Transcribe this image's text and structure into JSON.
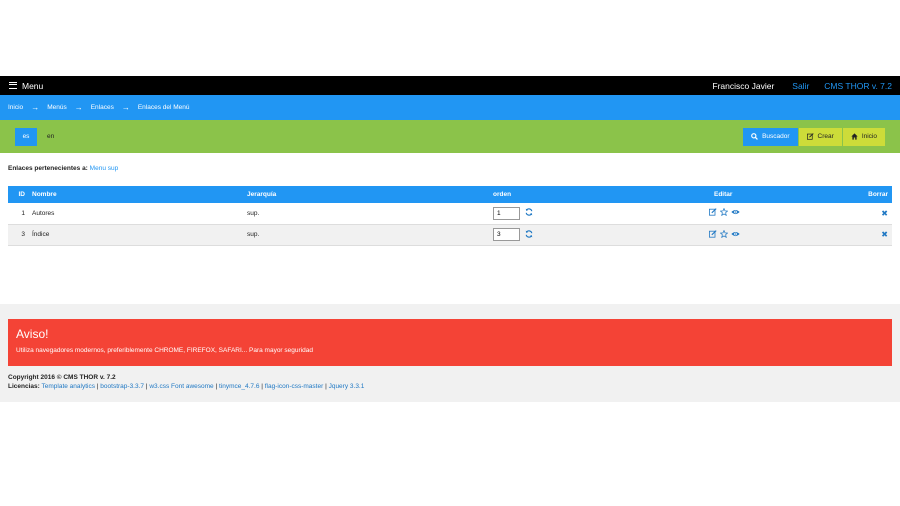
{
  "topbar": {
    "menu_label": "Menu",
    "user_name": "Francisco Javier",
    "logout_label": "Salir",
    "cms_version": "CMS THOR v. 7.2"
  },
  "breadcrumb": {
    "items": [
      "Inicio",
      "Menús",
      "Enlaces",
      "Enlaces del Menú"
    ],
    "separator": "→"
  },
  "languages": {
    "es": "es",
    "en": "en"
  },
  "actions": {
    "search": "Buscador",
    "create": "Crear",
    "home": "Inicio"
  },
  "links_heading": {
    "label": "Enlaces pertenecientes a:",
    "menu_name": "Menu sup"
  },
  "table": {
    "headers": {
      "id": "ID",
      "name": "Nombre",
      "hierarchy": "Jerarquía",
      "order": "orden",
      "edit": "Editar",
      "delete": "Borrar"
    },
    "rows": [
      {
        "id": "1",
        "name": "Autores",
        "hierarchy": "sup.",
        "order": "1"
      },
      {
        "id": "3",
        "name": "Índice",
        "hierarchy": "sup.",
        "order": "3"
      }
    ]
  },
  "footer": {
    "warning_title": "Aviso!",
    "warning_text": "Utiliza navegadores modernos, preferiblemente CHROME, FIREFOX, SAFARI... Para mayor seguridad",
    "copyright": "Copyright 2016 © CMS THOR v. 7.2",
    "licenses_label": "Licencias:",
    "licenses": [
      "Template analytics",
      "bootstrap-3.3.7",
      "w3.css Font awesome",
      "tinymce_4.7.6",
      "flag-icon-css-master",
      "Jquery 3.3.1"
    ],
    "license_separator": " | "
  },
  "colors": {
    "topbar": "#000000",
    "breadcrumb": "#2196F3",
    "langbar": "#8BC34A",
    "accent_blue": "#2196F3",
    "lime": "#CDDC39",
    "warning_red": "#f44336",
    "footer_bg": "#f1f1f1"
  },
  "icons": {
    "menu": "hamburger-icon",
    "search": "search-icon",
    "create": "edit-icon",
    "home": "home-icon",
    "row_actions": [
      "edit-icon",
      "star-icon",
      "eye-icon"
    ],
    "refresh": "refresh-icon",
    "delete": "close-icon"
  }
}
